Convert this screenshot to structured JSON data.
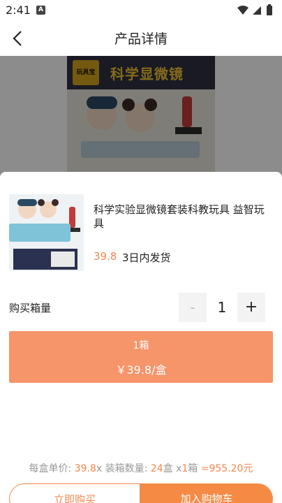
{
  "status_bar": {
    "time": "2:41",
    "badge": "A"
  },
  "header": {
    "title": "产品详情"
  },
  "hero": {
    "title": "科学显微镜",
    "logo_text": "玩具宝"
  },
  "product": {
    "name": "科学实验显微镜套装科教玩具 益智玩具",
    "price": "39.8",
    "shipping": "3日内发货"
  },
  "quantity": {
    "label": "购买箱量",
    "minus": "-",
    "value": "1",
    "plus": "+"
  },
  "pack_option": {
    "name": "1箱",
    "price": "￥39.8/盒"
  },
  "summary": {
    "unit_label": "每盒单价:",
    "unit_price": "39.8",
    "times1": "x",
    "box_label": "装箱数量:",
    "box_count": "24",
    "box_unit": "盒",
    "times2": "x",
    "case_count": "1",
    "case_unit": "箱",
    "total": "=955.20元"
  },
  "actions": {
    "buy_now": "立即购买",
    "add_cart": "加入购物车"
  },
  "colors": {
    "accent": "#f58a45",
    "card": "#f6946a",
    "price": "#f2874d"
  }
}
